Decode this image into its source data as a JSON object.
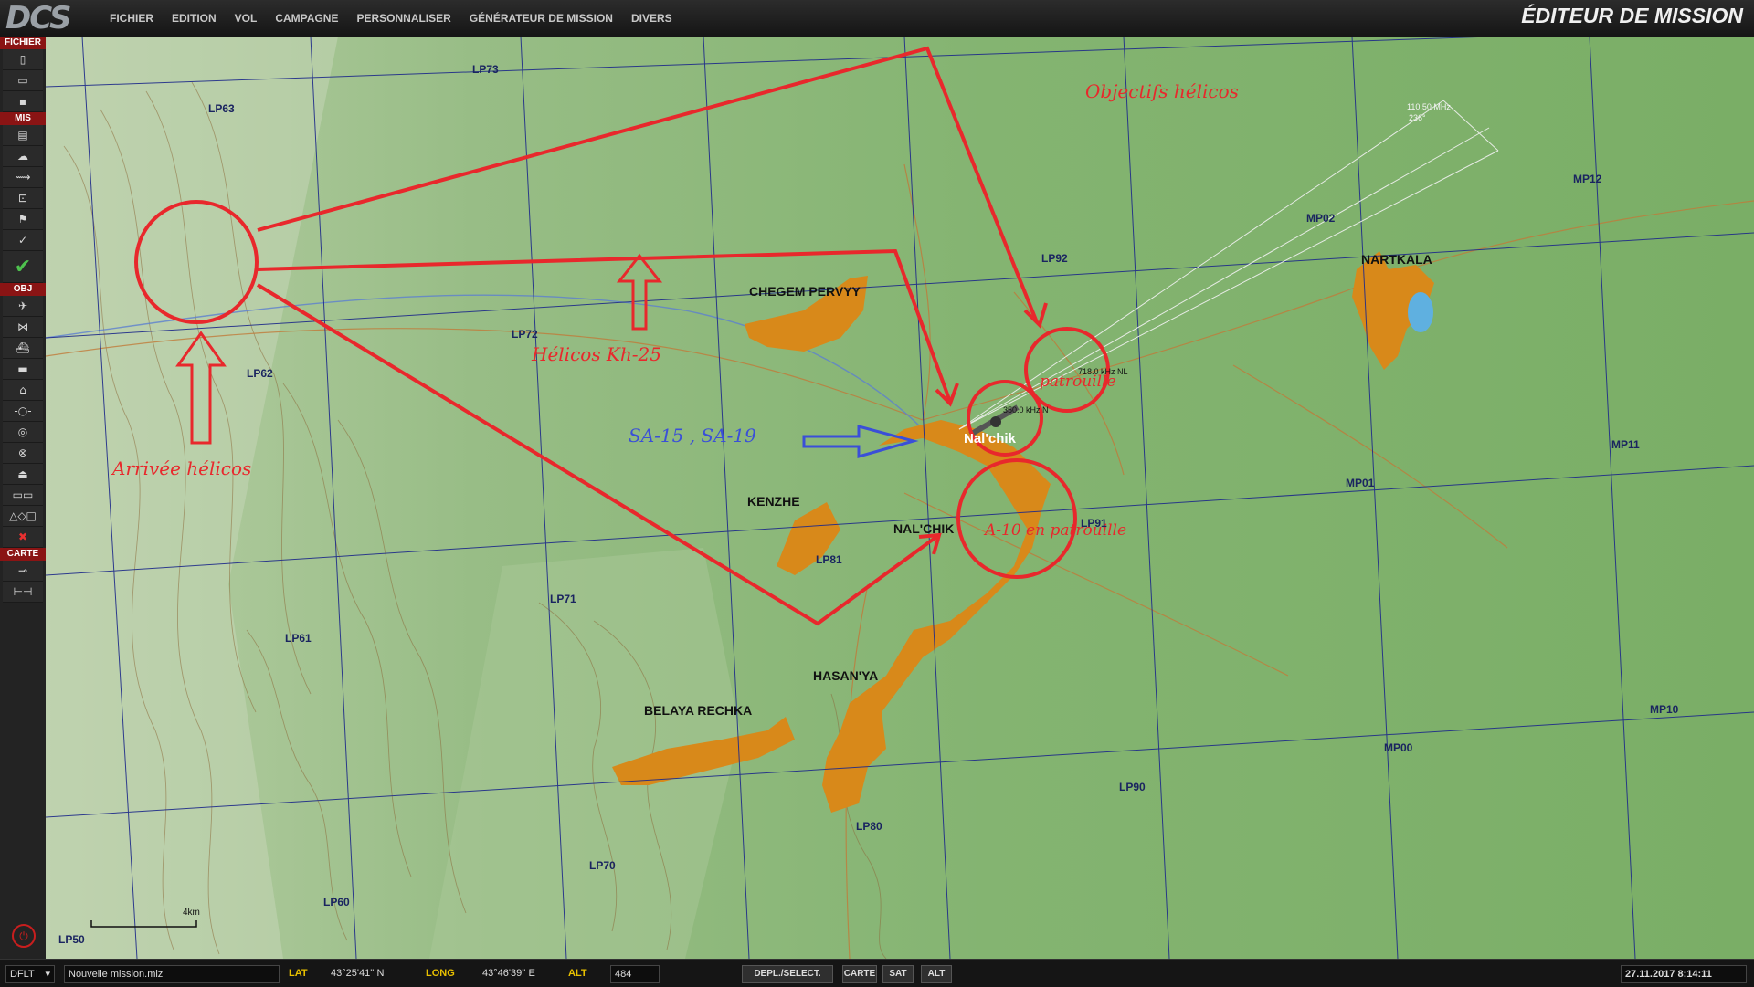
{
  "app": {
    "logo": "DCS",
    "title": "ÉDITEUR DE MISSION",
    "menu": [
      "FICHIER",
      "EDITION",
      "VOL",
      "CAMPAGNE",
      "PERSONNALISER",
      "GÉNÉRATEUR DE MISSION",
      "DIVERS"
    ]
  },
  "sidebar": {
    "sections": [
      "FICHIER",
      "MIS",
      "OBJ",
      "CARTE"
    ]
  },
  "map": {
    "grid_labels": [
      "LP73",
      "LP63",
      "LP72",
      "LP62",
      "LP92",
      "LP91",
      "LP81",
      "LP71",
      "LP61",
      "LP90",
      "LP80",
      "LP70",
      "LP60",
      "LP50",
      "MP12",
      "MP02",
      "MP11",
      "MP01",
      "MP10",
      "MP00"
    ],
    "towns": [
      "CHEGEM PERVYY",
      "NARTKALA",
      "KENZHE",
      "NAL'CHIK",
      "HASAN'YA",
      "BELAYA RECHKA"
    ],
    "airbase": "Nal'chik",
    "freq_ils": "110.50 MHz",
    "freq_ils_hdg": "236°",
    "freq_ndb": "718.0 kHz NL",
    "freq_ndb2": "350.0 kHz N",
    "scale": "4km",
    "annotations": {
      "objectives": "Objectifs hélicos",
      "helos": "Hélicos Kh-25",
      "arrival": "Arrivée hélicos",
      "sam": "SA-15 , SA-19",
      "patrol": "patrouille",
      "a10_patrol": "A-10 en patrouille"
    }
  },
  "status": {
    "coalition": "DFLT",
    "mission_file": "Nouvelle mission.miz",
    "lat_label": "LAT",
    "lat_value": "43°25'41'' N",
    "long_label": "LONG",
    "long_value": "43°46'39'' E",
    "alt_label": "ALT",
    "alt_value": "484",
    "mode_button": "DEPL./SELECT.",
    "map_buttons": [
      "CARTE",
      "SAT",
      "ALT"
    ],
    "datetime": "27.11.2017 8:14:11"
  },
  "colors": {
    "annotation_red": "#e8282c",
    "annotation_blue": "#3a4fd8",
    "urban": "#d8891a",
    "terrain": "#7fae6c",
    "grid": "#1e2a8a",
    "accent_yellow": "#e8c000"
  }
}
